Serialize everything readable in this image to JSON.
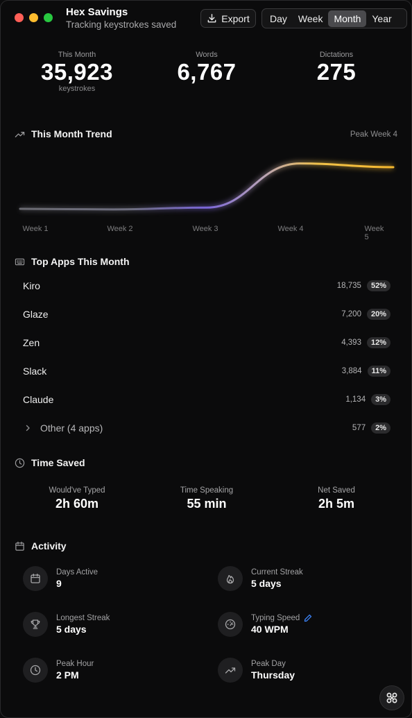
{
  "header": {
    "title": "Hex Savings",
    "subtitle": "Tracking keystrokes saved",
    "export_label": "Export",
    "ranges": [
      "Day",
      "Week",
      "Month",
      "Year"
    ],
    "selected_range": "Month"
  },
  "stats": [
    {
      "label": "This Month",
      "value": "35,923",
      "unit": "keystrokes"
    },
    {
      "label": "Words",
      "value": "6,767",
      "unit": ""
    },
    {
      "label": "Dictations",
      "value": "275",
      "unit": ""
    }
  ],
  "trend": {
    "title": "This Month Trend",
    "peak_label": "Peak Week 4",
    "chart_data": {
      "type": "line",
      "x": [
        "Week 1",
        "Week 2",
        "Week 3",
        "Week 4",
        "Week 5"
      ],
      "series": [
        {
          "values": [
            2400,
            2300,
            2600,
            9700,
            9100
          ]
        }
      ],
      "grid": false,
      "colors": [
        "#7a6fd6",
        "#f5c13a"
      ]
    }
  },
  "top_apps": {
    "title": "Top Apps This Month",
    "items": [
      {
        "name": "Kiro",
        "count": "18,735",
        "pct": "52%"
      },
      {
        "name": "Glaze",
        "count": "7,200",
        "pct": "20%"
      },
      {
        "name": "Zen",
        "count": "4,393",
        "pct": "12%"
      },
      {
        "name": "Slack",
        "count": "3,884",
        "pct": "11%"
      },
      {
        "name": "Claude",
        "count": "1,134",
        "pct": "3%"
      }
    ],
    "other": {
      "name": "Other (4 apps)",
      "count": "577",
      "pct": "2%"
    }
  },
  "time_saved": {
    "title": "Time Saved",
    "items": [
      {
        "label": "Would've Typed",
        "value": "2h 60m"
      },
      {
        "label": "Time Speaking",
        "value": "55 min"
      },
      {
        "label": "Net Saved",
        "value": "2h 5m"
      }
    ]
  },
  "activity": {
    "title": "Activity",
    "items": [
      {
        "label": "Days Active",
        "value": "9",
        "icon": "calendar-icon"
      },
      {
        "label": "Current Streak",
        "value": "5 days",
        "icon": "flame-icon"
      },
      {
        "label": "Longest Streak",
        "value": "5 days",
        "icon": "trophy-icon"
      },
      {
        "label": "Typing Speed",
        "value": "40 WPM",
        "icon": "speedometer-icon"
      },
      {
        "label": "Peak Hour",
        "value": "2 PM",
        "icon": "clock-icon"
      },
      {
        "label": "Peak Day",
        "value": "Thursday",
        "icon": "trend-icon"
      }
    ]
  },
  "colors": {
    "background": "#0b0b0c",
    "accent_purple": "#7a6fd6",
    "accent_gold": "#f5c13a",
    "edit_blue": "#3b82f6"
  }
}
